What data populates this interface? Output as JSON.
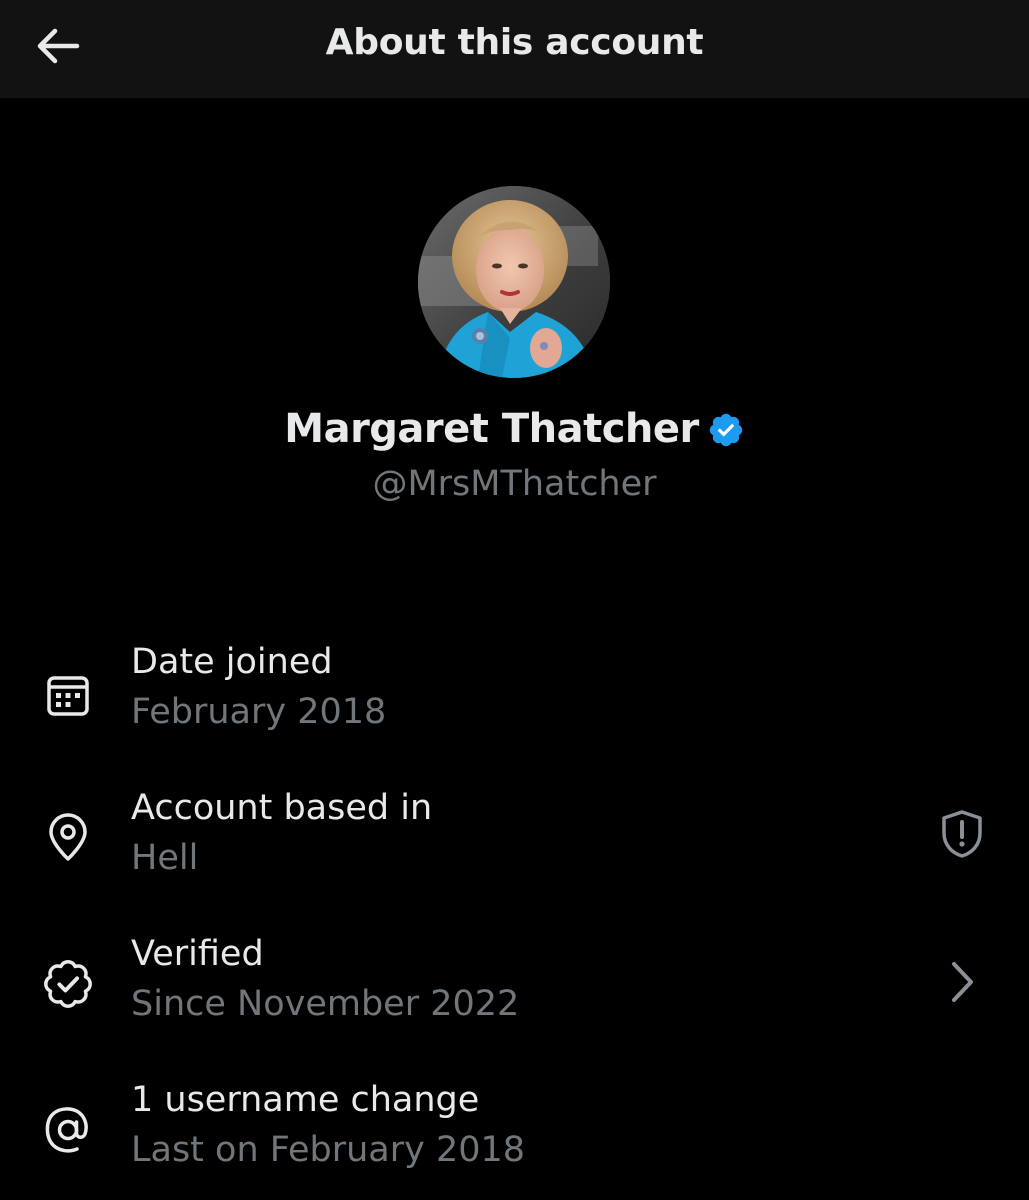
{
  "header": {
    "title": "About this account",
    "back_icon": "arrow-left-icon"
  },
  "profile": {
    "avatar_alt": "profile photo",
    "display_name": "Margaret Thatcher",
    "handle": "@MrsMThatcher",
    "verified_badge_color": "#1d9bf0"
  },
  "details": [
    {
      "icon": "calendar-icon",
      "title": "Date joined",
      "value": "February 2018"
    },
    {
      "icon": "location-pin-icon",
      "title": "Account based in",
      "value": "Hell",
      "trailing_icon": "shield-alert-icon"
    },
    {
      "icon": "verified-badge-outline-icon",
      "title": "Verified",
      "value": "Since November 2022",
      "trailing_icon": "chevron-right-icon"
    },
    {
      "icon": "at-sign-icon",
      "title": "1 username change",
      "value": "Last on February 2018"
    }
  ],
  "colors": {
    "background": "#000000",
    "header_background": "#121212",
    "primary_text": "#e7e9ea",
    "secondary_text": "#71767b",
    "accent": "#1d9bf0"
  }
}
